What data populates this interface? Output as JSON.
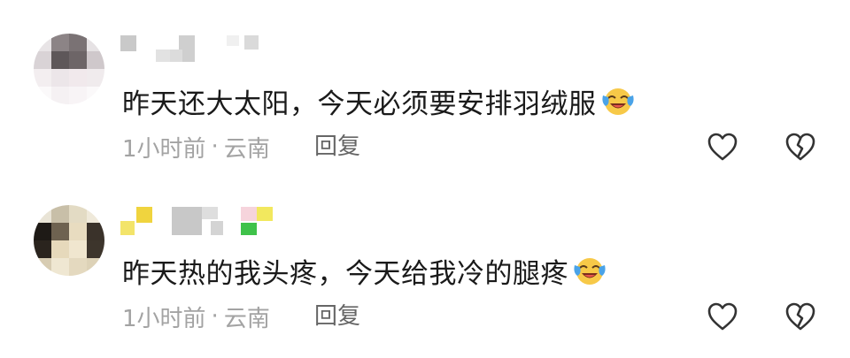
{
  "comments": [
    {
      "text": "昨天还大太阳，今天必须要安排羽绒服",
      "emoji": "laughing-crying-emoji",
      "time": "1小时前",
      "separator": "·",
      "location": "云南",
      "reply_label": "回复",
      "like_icon": "heart-outline-icon",
      "dislike_icon": "broken-heart-icon"
    },
    {
      "text": "昨天热的我头疼，今天给我冷的腿疼",
      "emoji": "laughing-crying-emoji",
      "time": "1小时前",
      "separator": "·",
      "location": "云南",
      "reply_label": "回复",
      "like_icon": "heart-outline-icon",
      "dislike_icon": "broken-heart-icon"
    }
  ],
  "colors": {
    "text": "#1a1a1a",
    "meta": "#a3a3a3",
    "reply": "#666666",
    "icon": "#333333",
    "emoji_face": "#f7c948"
  }
}
